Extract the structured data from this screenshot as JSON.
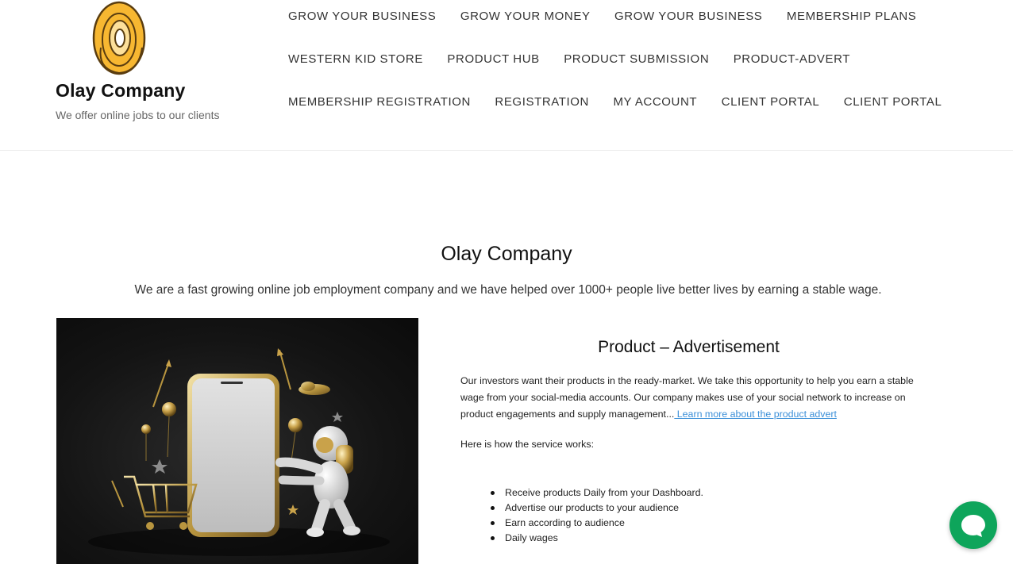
{
  "header": {
    "site_title": "Olay Company",
    "tagline": "We offer online jobs to our clients",
    "logo_icon": "spiral-logo-icon",
    "brand_color": "#f7b731"
  },
  "nav": {
    "row1": [
      "GROW YOUR BUSINESS",
      "GROW YOUR MONEY",
      "GROW YOUR BUSINESS",
      "MEMBERSHIP PLANS"
    ],
    "row2": [
      "WESTERN KID STORE",
      "PRODUCT HUB",
      "PRODUCT SUBMISSION",
      "PRODUCT-ADVERT"
    ],
    "row3": [
      "MEMBERSHIP REGISTRATION",
      "REGISTRATION",
      "MY ACCOUNT",
      "CLIENT PORTAL",
      "CLIENT PORTAL"
    ]
  },
  "intro": {
    "title": "Olay Company",
    "text": "We are a fast growing online job employment company and we have helped over 1000+ people live better lives by earning a stable wage."
  },
  "product": {
    "title": "Product – Advertisement",
    "paragraph": "Our investors want their products in the ready-market. We take this opportunity to help you earn a stable wage from your social-media accounts. Our company makes use of your social network to increase on product engagements and supply management...",
    "link_text": " Learn more about the product advert",
    "how_it_works": "Here is how the service works:",
    "items": [
      "Receive products Daily from your Dashboard.",
      "Advertise our products to your audience",
      "Earn according to audience",
      "Daily wages"
    ]
  },
  "chat": {
    "icon": "chat-bubble-icon",
    "color": "#0ea55b"
  }
}
